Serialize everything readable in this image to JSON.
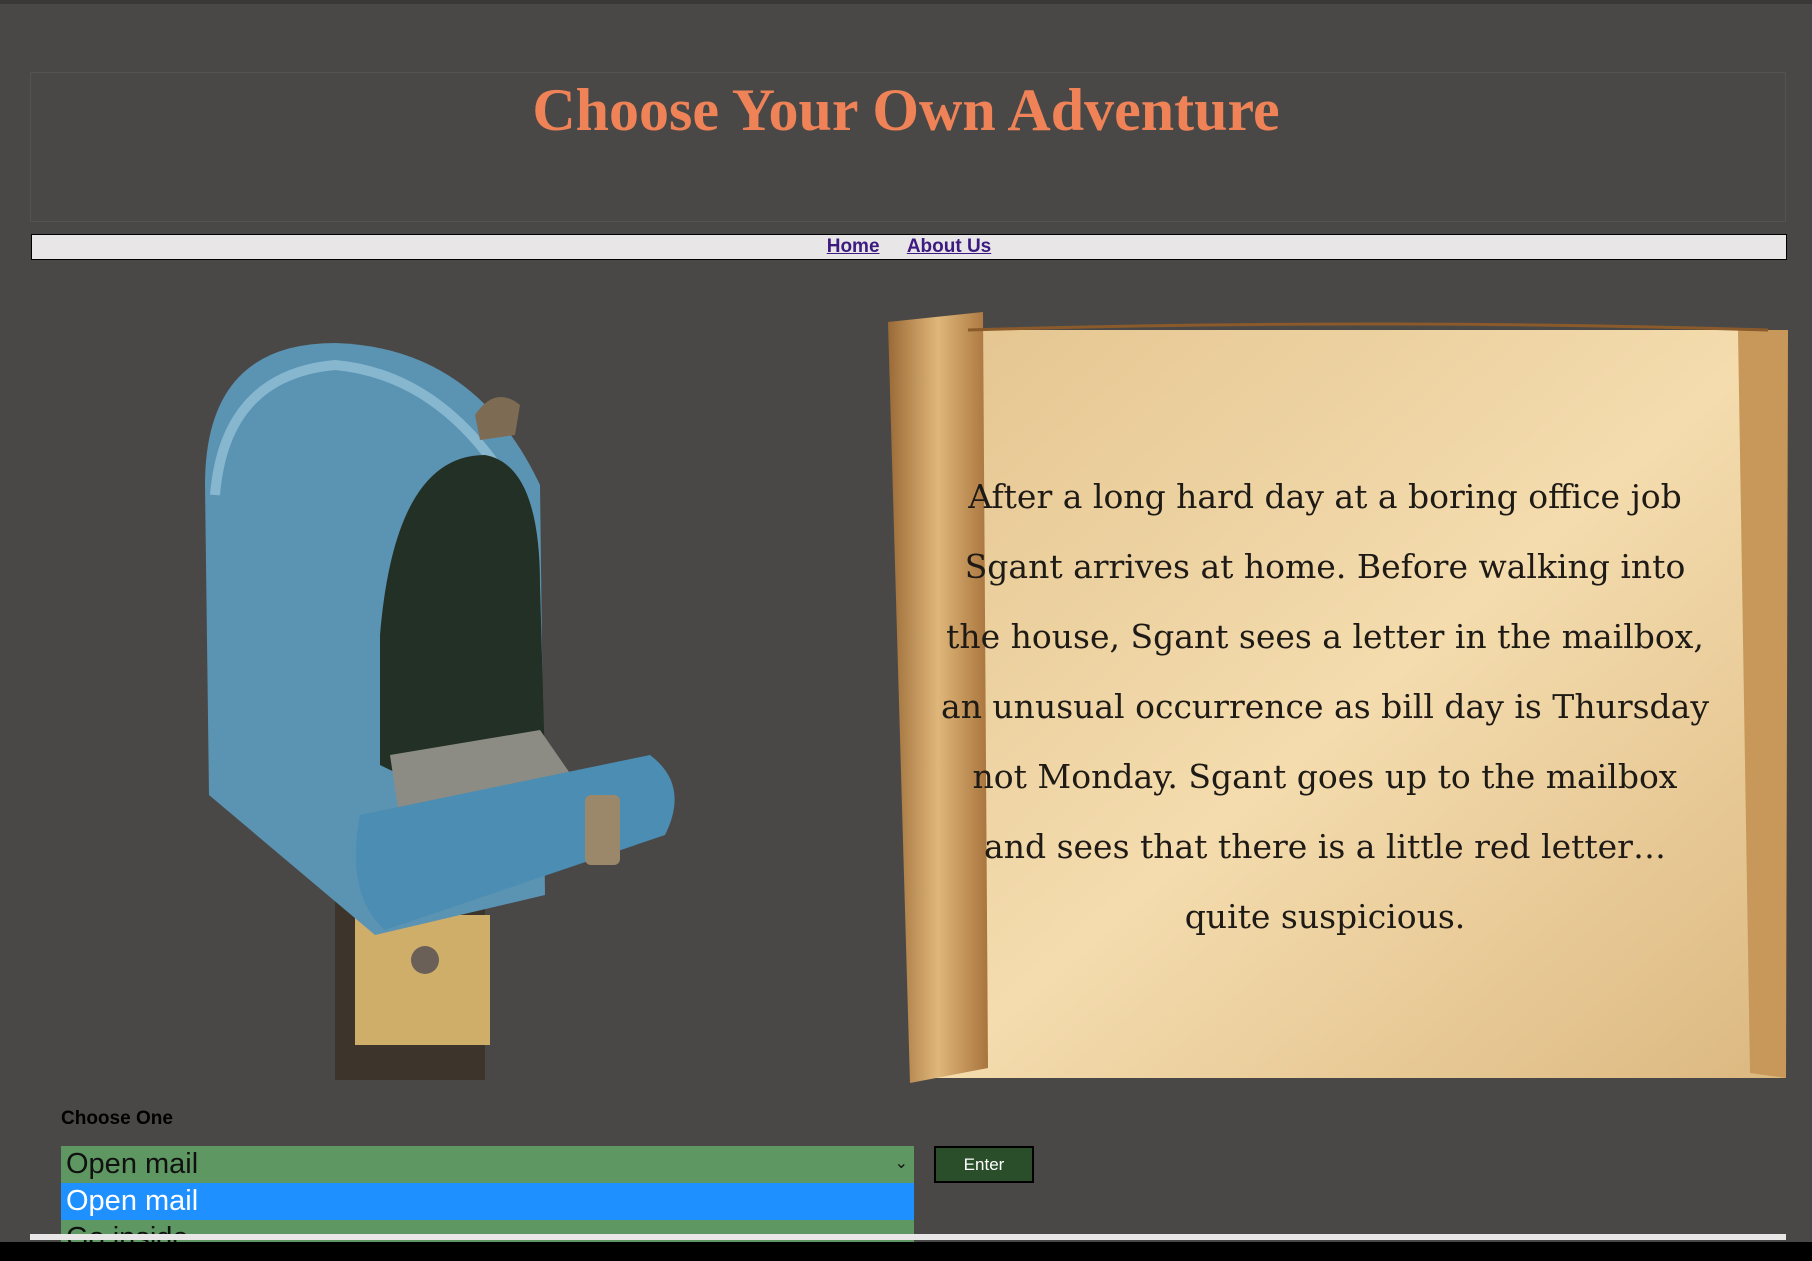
{
  "header": {
    "title": "Choose Your Own Adventure",
    "title_color": "#f08257"
  },
  "nav": {
    "links": [
      {
        "label": "Home"
      },
      {
        "label": "About Us"
      }
    ]
  },
  "images": {
    "mailbox": "mailbox-photo",
    "scroll": "parchment-scroll"
  },
  "story": {
    "text": "After a long hard day at a boring office job Sgant arrives at home. Before walking into the house, Sgant sees a letter in the mailbox, an unusual occurrence as bill day is Thursday not Monday. Sgant goes up to the mailbox and sees that there is a little red letter… quite suspicious."
  },
  "form": {
    "label": "Choose One",
    "selected": "Open mail",
    "options": [
      {
        "label": "Open mail"
      },
      {
        "label": "Go inside"
      }
    ],
    "enter_label": "Enter",
    "select_color": "#5e9761",
    "highlight_color": "#1e90ff"
  },
  "colors": {
    "background": "#4a4846",
    "nav_bg": "#e8e6e6",
    "link": "#3e1b80"
  }
}
